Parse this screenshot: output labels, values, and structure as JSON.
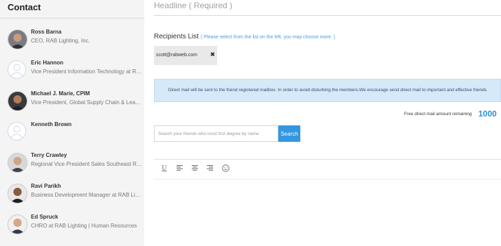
{
  "sidebar": {
    "title": "Contact",
    "contacts": [
      {
        "name": "Ross Barna",
        "title": "CEO, RAB Lighting, Inc.",
        "avatar": "photo"
      },
      {
        "name": "Eric Hannon",
        "title": "Vice President Information Technology at RAB Lighting",
        "avatar": "placeholder"
      },
      {
        "name": "Michael J. Marie, CPIM",
        "title": "Vice President, Global Supply Chain & Lean Manufacturing",
        "avatar": "photo"
      },
      {
        "name": "Kenneth Brown",
        "title": "",
        "avatar": "placeholder"
      },
      {
        "name": "Terry Crawley",
        "title": "Regional Vice President Sales Southeast Region",
        "avatar": "photo"
      },
      {
        "name": "Ravi Parikh",
        "title": "Business Development Manager at RAB Lighting",
        "avatar": "photo"
      },
      {
        "name": "Ed Spruck",
        "title": "CHRO at RAB Lighting | Human Resources",
        "avatar": "photo"
      }
    ]
  },
  "form": {
    "headline_placeholder": "Headline ( Required )",
    "recipients_label": "Recipients List",
    "recipients_hint": "( Please select from the list on the left, you may choose more. )",
    "recipient_chip": "scott@rabweb.com",
    "chip_remove": "✖",
    "notice": "Direct mail will be sent to the friend registered mailbox. In order to avoid disturbing the members.We encourage send direct mail to important and effective friends",
    "quota_label": "Free direct mail amount remaining",
    "quota_value": "1000",
    "search_placeholder": "Search your friends who isnot first degree by name",
    "search_button": "Search"
  },
  "toolbar": {
    "icons": [
      "underline-icon",
      "align-left-icon",
      "align-center-icon",
      "align-right-icon",
      "emoji-icon"
    ],
    "underline_label": "U"
  }
}
